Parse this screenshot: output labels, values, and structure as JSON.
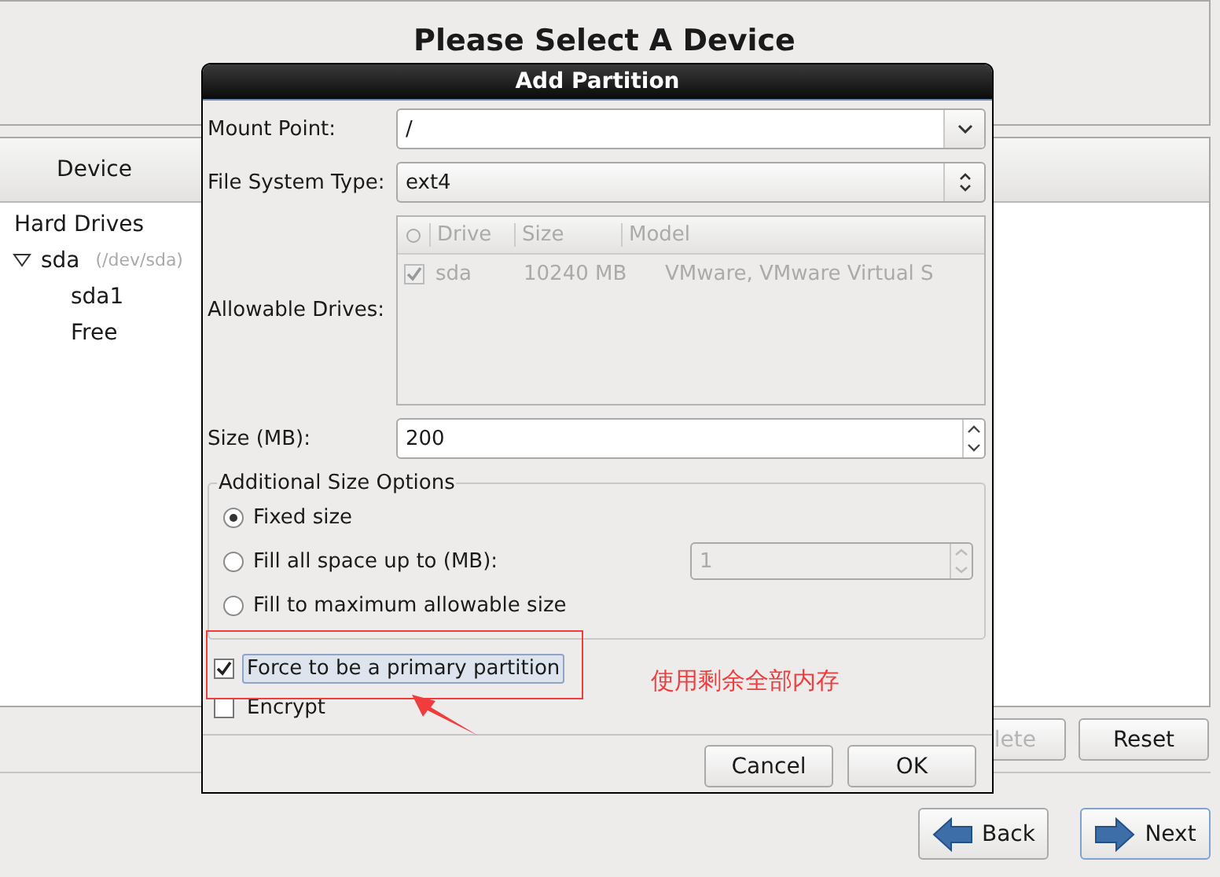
{
  "page": {
    "title": "Please Select A Device"
  },
  "device_panel": {
    "column": "Device",
    "tree": [
      {
        "label": "Hard Drives",
        "children": [
          {
            "label": "sda",
            "detail": "(/dev/sda)",
            "expanded": true,
            "children": [
              {
                "label": "sda1"
              },
              {
                "label": "Free"
              }
            ]
          }
        ]
      }
    ]
  },
  "panel_buttons": [
    {
      "label": "lete",
      "disabled": true
    },
    {
      "label": "Reset",
      "disabled": false
    }
  ],
  "nav_buttons": [
    {
      "label": "Back",
      "kind": "back",
      "focused": false
    },
    {
      "label": "Next",
      "kind": "next",
      "focused": true
    }
  ],
  "dialog": {
    "title": "Add Partition",
    "mount_point": {
      "label": "Mount Point:",
      "value": "/"
    },
    "file_system_type": {
      "label": "File System Type:",
      "value": "ext4"
    },
    "allowable_drives": {
      "label": "Allowable Drives:",
      "disabled": true,
      "columns": [
        "Drive",
        "Size",
        "Model"
      ],
      "rows": [
        {
          "checked": true,
          "drive": "sda",
          "size": "10240 MB",
          "model": "VMware, VMware Virtual S"
        }
      ]
    },
    "size": {
      "label": "Size (MB):",
      "value": "200"
    },
    "size_options": {
      "legend": "Additional Size Options",
      "options": [
        {
          "label": "Fixed size",
          "selected": true
        },
        {
          "label": "Fill all space up to (MB):",
          "selected": false,
          "value": "1"
        },
        {
          "label": "Fill to maximum allowable size",
          "selected": false
        }
      ]
    },
    "checkboxes": [
      {
        "label": "Force to be a primary partition",
        "checked": true,
        "focused": true
      },
      {
        "label": "Encrypt",
        "checked": false,
        "focused": false
      }
    ],
    "buttons": [
      "Cancel",
      "OK"
    ]
  },
  "annotation": {
    "text": "使用剩余全部内存"
  }
}
